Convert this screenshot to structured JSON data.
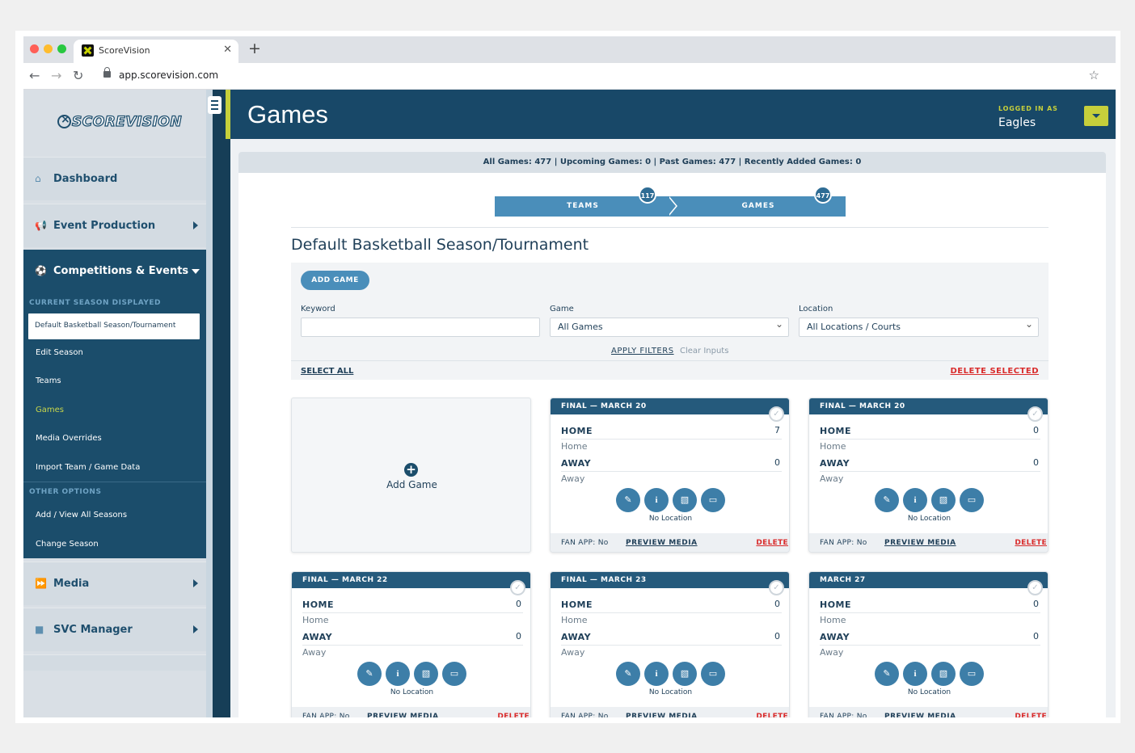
{
  "browser": {
    "tab_title": "ScoreVision",
    "url": "app.scorevision.com",
    "colors": {
      "close": "#ff5f57",
      "minimize": "#febc2e",
      "maximize": "#28c840"
    }
  },
  "sidebar": {
    "logo_text": "SCOREVISION",
    "nav": [
      {
        "label": "Dashboard",
        "icon": "home-icon"
      },
      {
        "label": "Event Production",
        "icon": "megaphone-icon"
      },
      {
        "label": "Competitions & Events",
        "icon": "soccer-ball-icon"
      },
      {
        "label": "Media",
        "icon": "fast-forward-icon"
      },
      {
        "label": "SVC Manager",
        "icon": "video-camera-icon"
      }
    ],
    "current_season_label": "CURRENT SEASON DISPLAYED",
    "current_season": "Default Basketball Season/Tournament",
    "sub_items": [
      "Edit Season",
      "Teams",
      "Games",
      "Media Overrides",
      "Import Team / Game Data"
    ],
    "other_options_label": "OTHER OPTIONS",
    "other_items": [
      "Add / View All Seasons",
      "Change Season"
    ]
  },
  "header": {
    "title": "Games",
    "logged_in_label": "LOGGED IN AS",
    "user": "Eagles"
  },
  "stats": "All Games: 477 | Upcoming Games: 0 | Past Games: 477 | Recently Added Games: 0",
  "steps": [
    {
      "label": "TEAMS",
      "count": "117"
    },
    {
      "label": "GAMES",
      "count": "477"
    }
  ],
  "season_title": "Default Basketball Season/Tournament",
  "filters": {
    "add_game": "ADD GAME",
    "keyword_label": "Keyword",
    "keyword_value": "",
    "game_label": "Game",
    "game_value": "All Games",
    "location_label": "Location",
    "location_value": "All Locations / Courts",
    "apply": "APPLY FILTERS",
    "clear": "Clear Inputs",
    "select_all": "SELECT ALL",
    "delete_selected": "DELETE SELECTED"
  },
  "add_card_label": "Add Game",
  "games": [
    {
      "header": "FINAL — MARCH 20",
      "home_label": "HOME",
      "home_name": "Home",
      "home_score": "7",
      "away_label": "AWAY",
      "away_name": "Away",
      "away_score": "0",
      "location": "No Location",
      "fan_app": "FAN APP: No",
      "preview": "PREVIEW MEDIA",
      "delete": "DELETE"
    },
    {
      "header": "FINAL — MARCH 20",
      "home_label": "HOME",
      "home_name": "Home",
      "home_score": "0",
      "away_label": "AWAY",
      "away_name": "Away",
      "away_score": "0",
      "location": "No Location",
      "fan_app": "FAN APP: No",
      "preview": "PREVIEW MEDIA",
      "delete": "DELETE"
    },
    {
      "header": "FINAL — MARCH 22",
      "home_label": "HOME",
      "home_name": "Home",
      "home_score": "0",
      "away_label": "AWAY",
      "away_name": "Away",
      "away_score": "0",
      "location": "No Location",
      "fan_app": "FAN APP: No",
      "preview": "PREVIEW MEDIA",
      "delete": "DELETE"
    },
    {
      "header": "FINAL — MARCH 23",
      "home_label": "HOME",
      "home_name": "Home",
      "home_score": "0",
      "away_label": "AWAY",
      "away_name": "Away",
      "away_score": "0",
      "location": "No Location",
      "fan_app": "FAN APP: No",
      "preview": "PREVIEW MEDIA",
      "delete": "DELETE"
    },
    {
      "header": "MARCH 27",
      "home_label": "HOME",
      "home_name": "Home",
      "home_score": "0",
      "away_label": "AWAY",
      "away_name": "Away",
      "away_score": "0",
      "location": "No Location",
      "fan_app": "FAN APP: No",
      "preview": "PREVIEW MEDIA",
      "delete": "DELETE"
    }
  ],
  "theme": {
    "navy": "#184868",
    "accent": "#c6cf3b",
    "button": "#4a8eba",
    "danger": "#d92c2c"
  }
}
